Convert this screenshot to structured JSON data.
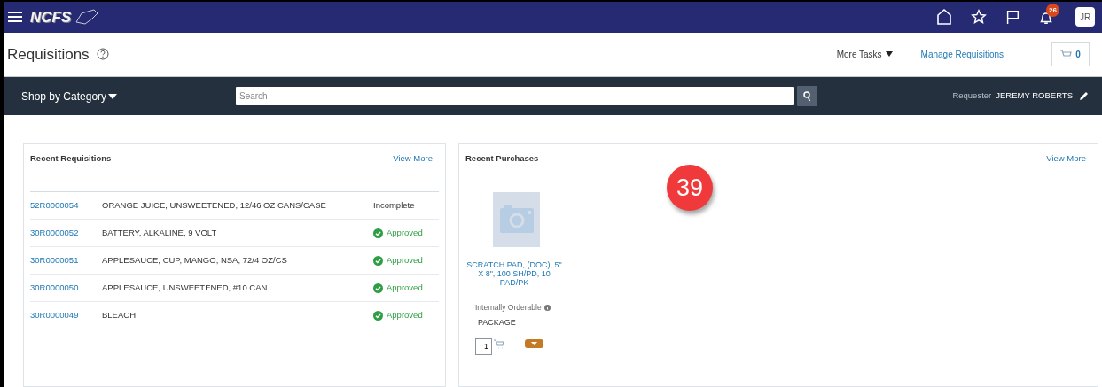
{
  "top_bar": {
    "logo": "NCFS",
    "notification_count": "26",
    "user_initials": "JR"
  },
  "header": {
    "title": "Requisitions",
    "more_tasks": "More Tasks",
    "manage_link": "Manage Requisitions",
    "cart_count": "0"
  },
  "shop_bar": {
    "category_menu": "Shop by Category",
    "search": {
      "placeholder": "Search"
    },
    "requester_label": "Requester",
    "requester_name": "JEREMY ROBERTS"
  },
  "recent_requisitions": {
    "title": "Recent Requisitions",
    "view_more": "View More",
    "rows": [
      {
        "number": "52R0000054",
        "description": "ORANGE JUICE, UNSWEETENED, 12/46 OZ CANS/CASE",
        "status": "Incomplete",
        "kind": "incomplete"
      },
      {
        "number": "30R0000052",
        "description": "BATTERY, ALKALINE, 9 VOLT",
        "status": "Approved",
        "kind": "approved"
      },
      {
        "number": "30R0000051",
        "description": "APPLESAUCE, CUP, MANGO, NSA, 72/4 OZ/CS",
        "status": "Approved",
        "kind": "approved"
      },
      {
        "number": "30R0000050",
        "description": "APPLESAUCE, UNSWEETENED, #10 CAN",
        "status": "Approved",
        "kind": "approved"
      },
      {
        "number": "30R0000049",
        "description": "BLEACH",
        "status": "Approved",
        "kind": "approved"
      }
    ]
  },
  "recent_purchases": {
    "title": "Recent Purchases",
    "view_more": "View More",
    "items": [
      {
        "name": "SCRATCH PAD, (DOC), 5\" X 8\", 100 SH/PD, 10 PAD/PK",
        "availability": "Internally Orderable",
        "unit": "PACKAGE",
        "quantity": "1"
      }
    ]
  },
  "step_marker": "39"
}
